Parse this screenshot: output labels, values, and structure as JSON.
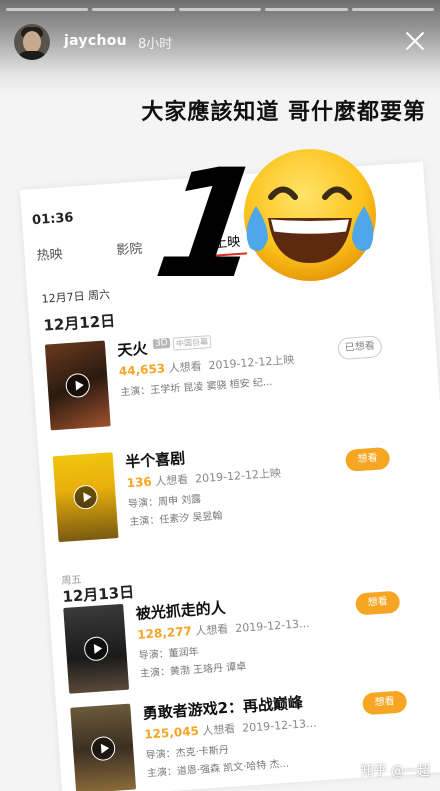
{
  "story": {
    "username": "jaychou",
    "time_ago": "8小时",
    "caption": "大家應該知道 哥什麼都要第",
    "big_number": "1",
    "watermark": "知乎 @一超"
  },
  "phone": {
    "status_time": "01:36",
    "tabs": [
      {
        "label": "热映",
        "active": false
      },
      {
        "label": "影院",
        "active": false
      },
      {
        "label": "待映",
        "active": false
      },
      {
        "label": "待上映",
        "active": true
      }
    ],
    "first_date": "12月7日 周六",
    "groups": [
      {
        "date": "12月12日",
        "weekday": "",
        "movies": [
          {
            "title": "天火",
            "tag3d": "3D",
            "tag_format": "中国巨幕",
            "want_count": "44,653",
            "want_label": "人想看",
            "release": "2019-12-12上映",
            "line2": "主演：王学圻 昆凌 窦骁 桓安 纪...",
            "line3": "",
            "button": "已想看",
            "button_style": "outline"
          },
          {
            "title": "半个喜剧",
            "want_count": "136",
            "want_label": "人想看",
            "release": "2019-12-12上映",
            "line2": "导演：周申 刘露",
            "line3": "主演：任素汐 吴昱翰",
            "button": "想看",
            "button_style": "filled"
          }
        ]
      },
      {
        "date": "12月13日",
        "weekday": "周五",
        "movies": [
          {
            "title": "被光抓走的人",
            "want_count": "128,277",
            "want_label": "人想看",
            "release": "2019-12-13...",
            "line2": "导演：董润年",
            "line3": "主演：黄渤 王珞丹 谭卓",
            "button": "想看",
            "button_style": "filled"
          },
          {
            "title": "勇敢者游戏2：再战巅峰",
            "want_count": "125,045",
            "want_label": "人想看",
            "release": "2019-12-13...",
            "line2": "导演：杰克·卡斯丹",
            "line3": "主演：道恩·强森 凯文·哈特 杰...",
            "button": "想看",
            "button_style": "filled"
          }
        ]
      }
    ]
  },
  "colors": {
    "accent_orange": "#f6a623",
    "want_number": "#f5a623",
    "tab_underline": "#e02e24"
  }
}
